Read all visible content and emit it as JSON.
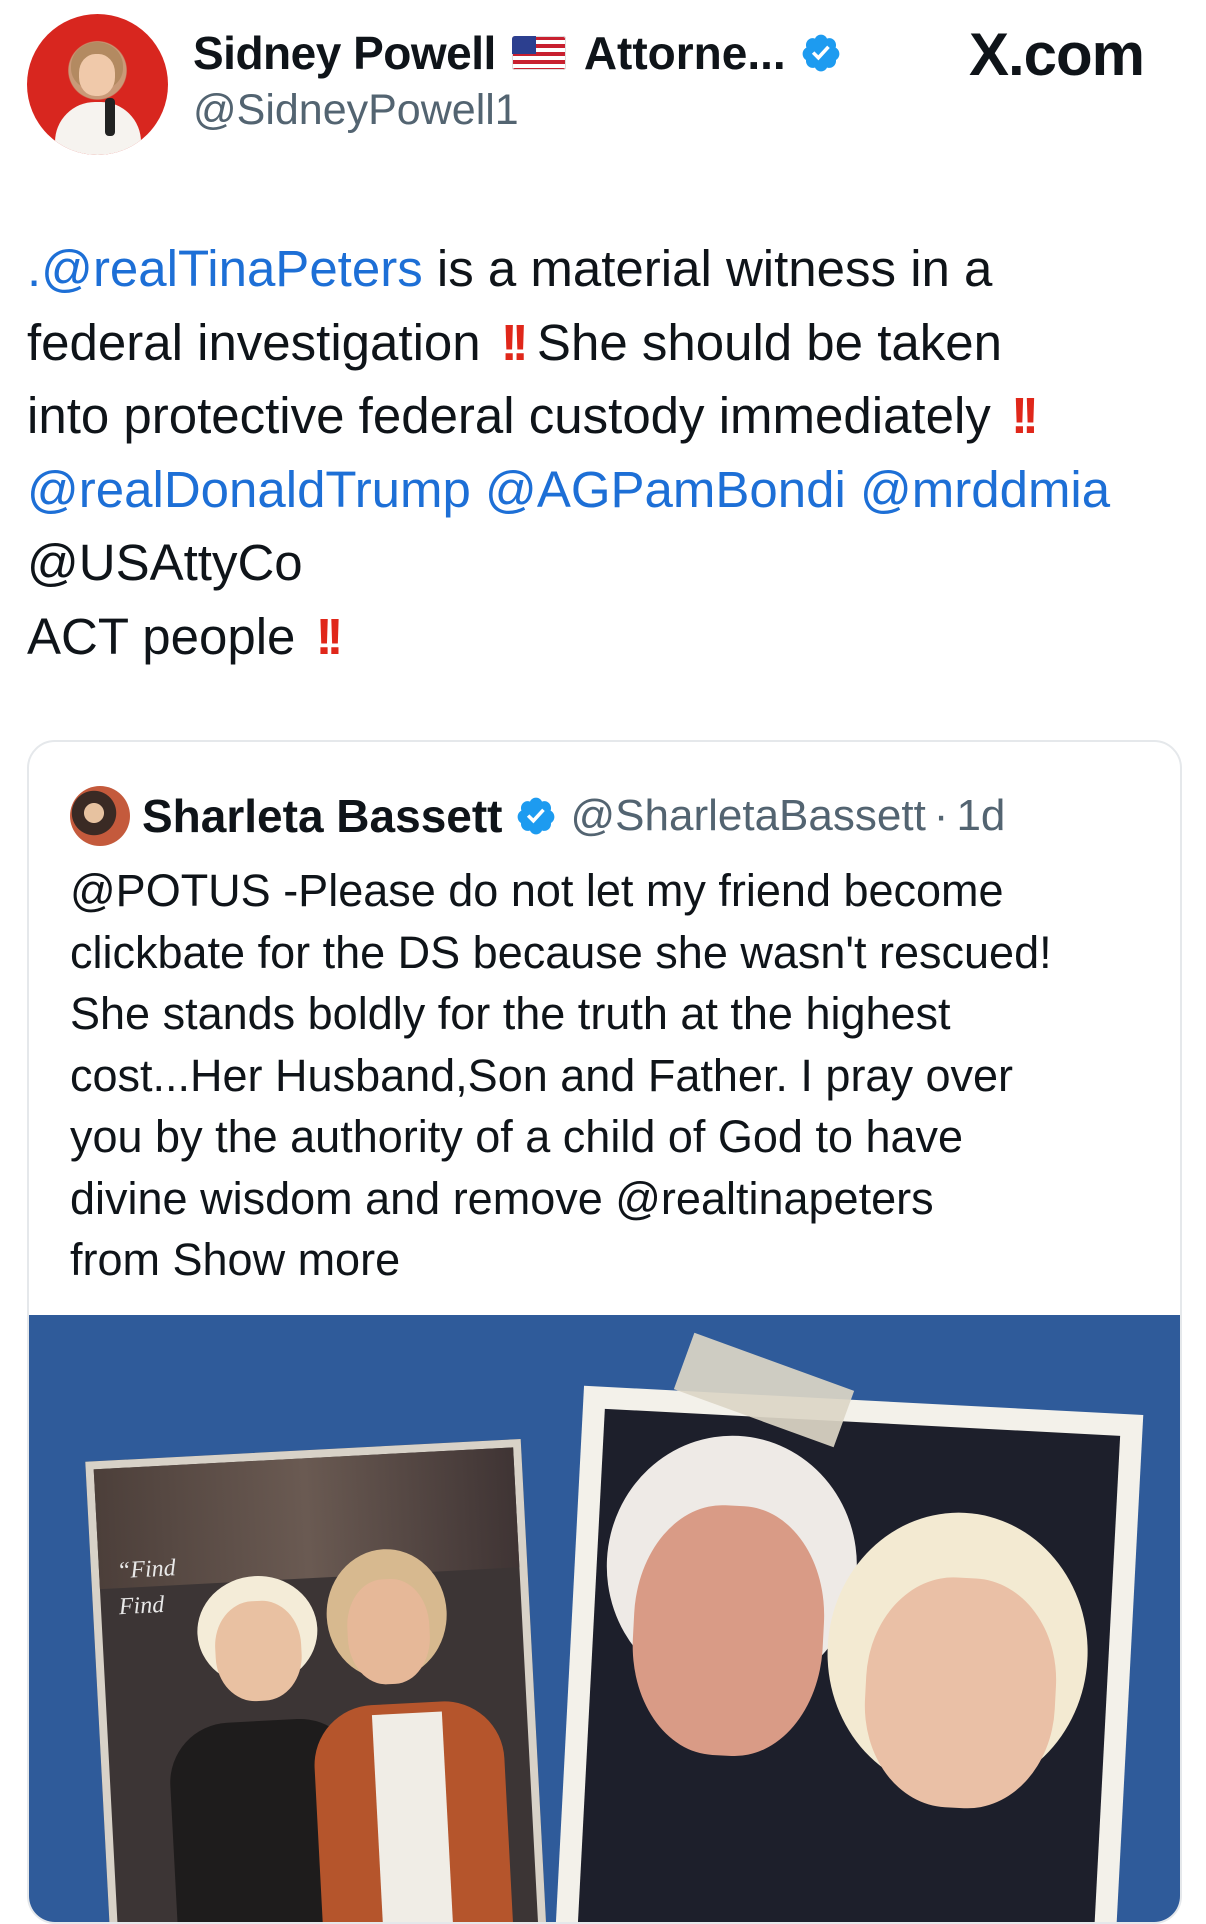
{
  "author": {
    "name": "Sidney Powell",
    "title_truncated": "Attorne...",
    "handle": "@SidneyPowell1"
  },
  "brand": {
    "site": "X.com"
  },
  "post": {
    "lines": [
      {
        "mention": ".@realTinaPeters",
        "text": " is a material witness in a",
        "bang": ""
      },
      {
        "mention": "",
        "text": "federal investigation ",
        "bang": "!!",
        "after": " She should be taken"
      },
      {
        "mention": "",
        "text": "into protective federal custody immediately ",
        "bang": "!!"
      },
      {
        "mention": "@realDonaldTrump @AGPamBondi @mrddmia",
        "text": "",
        "bang": ""
      },
      {
        "mention": "",
        "text": "@USAttyCo",
        "bang": ""
      },
      {
        "mention": "",
        "text": "ACT people ",
        "bang": "!!"
      }
    ]
  },
  "quote": {
    "name": "Sharleta Bassett",
    "handle": "@SharletaBassett",
    "separator": "·",
    "time": "1d",
    "lines": [
      "@POTUS -Please do not let my friend become",
      "clickbate for the DS because she wasn't rescued!",
      "She stands boldly for the truth at the highest",
      "cost...Her Husband,Son and Father. I pray over",
      "you by the authority of a child of God to have",
      "divine wisdom and remove @realtinapeters",
      "from Show more"
    ],
    "image": {
      "sign_text_1": "“Find",
      "sign_text_2": "Find"
    }
  },
  "colors": {
    "mention": "#1d6fd6",
    "bang": "#e0271a",
    "verified": "#1d9bf0",
    "muted": "#536471",
    "image_bg": "#2f5b9a"
  },
  "icons": {
    "verified": "verified-badge-icon",
    "flag": "us-flag-icon"
  }
}
